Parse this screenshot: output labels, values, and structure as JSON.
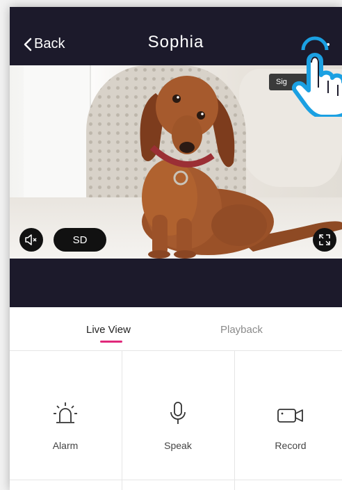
{
  "header": {
    "back_label": "Back",
    "title": "Sophia"
  },
  "video": {
    "badge_text": "Sig",
    "quality_label": "SD"
  },
  "tabs": [
    {
      "label": "Live View",
      "active": true
    },
    {
      "label": "Playback",
      "active": false
    }
  ],
  "actions": [
    {
      "label": "Alarm",
      "icon": "alarm-icon"
    },
    {
      "label": "Speak",
      "icon": "microphone-icon"
    },
    {
      "label": "Record",
      "icon": "video-camera-icon"
    }
  ],
  "colors": {
    "header_bg": "#1c1a2b",
    "accent": "#e0287a",
    "hand_outline": "#1ba0e2"
  }
}
